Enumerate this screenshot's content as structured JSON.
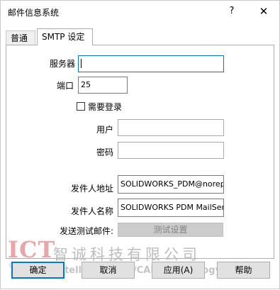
{
  "window": {
    "title": "邮件信息系统",
    "help_label": "?",
    "close_label": "✕"
  },
  "tabs": [
    {
      "label": "普通"
    },
    {
      "label": "SMTP 设定"
    }
  ],
  "form": {
    "server_label": "服务器",
    "server_value": "",
    "port_label": "端口",
    "port_value": "25",
    "login_checkbox_label": "需要登录",
    "login_checked": false,
    "user_label": "用户",
    "user_value": "",
    "password_label": "密码",
    "password_value": "",
    "sender_address_label": "发件人地址",
    "sender_address_value": "SOLIDWORKS_PDM@norepl",
    "sender_name_label": "发件人名称",
    "sender_name_value": "SOLIDWORKS PDM MailServ",
    "send_test_label": "发送测试邮件:",
    "test_settings_button": "测试设置"
  },
  "watermark": {
    "logo": "ICT",
    "logo_sub": "CAD/CAM",
    "company_cn": "智诚科技有限公司",
    "company_en": "Intelligent CAD/CAM Technology Ltd."
  },
  "buttons": {
    "ok": "确定",
    "cancel": "取消",
    "apply": "应用(A)",
    "help": "帮助"
  },
  "colors": {
    "accent": "#0078d7",
    "button_bg": "#e1e1e1",
    "disabled_bg": "#cccccc"
  }
}
